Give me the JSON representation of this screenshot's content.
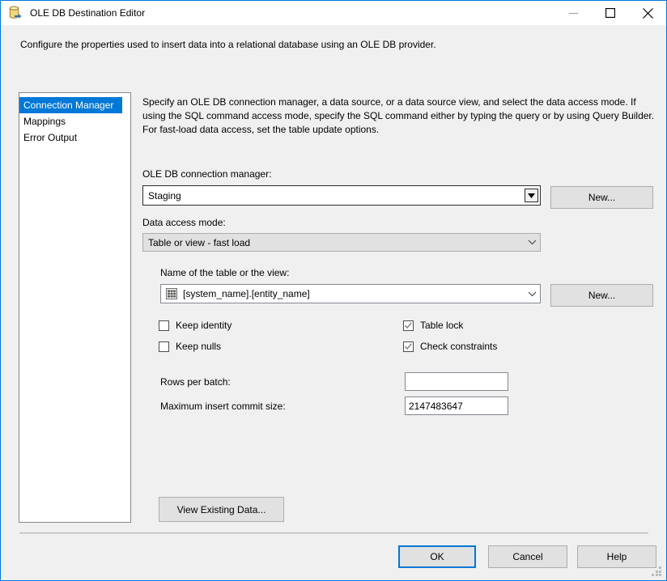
{
  "window": {
    "title": "OLE DB Destination Editor",
    "icon": "database-destination-icon",
    "minimize_label": "Minimize",
    "maximize_label": "Maximize",
    "close_label": "Close"
  },
  "header": {
    "description": "Configure the properties used to insert data into a relational database using an OLE DB provider."
  },
  "nav": {
    "items": [
      {
        "label": "Connection Manager",
        "selected": true
      },
      {
        "label": "Mappings",
        "selected": false
      },
      {
        "label": "Error Output",
        "selected": false
      }
    ]
  },
  "pane": {
    "description": "Specify an OLE DB connection manager, a data source, or a data source view, and select the data access mode. If using the SQL command access mode, specify the SQL command either by typing the query or by using Query Builder. For fast-load data access, set the table update options.",
    "connection_manager": {
      "label": "OLE DB connection manager:",
      "value": "Staging",
      "new_button": "New..."
    },
    "data_access_mode": {
      "label": "Data access mode:",
      "value": "Table or view - fast load"
    },
    "table_or_view": {
      "label": "Name of the table or the view:",
      "value": "[system_name].[entity_name]",
      "icon": "table-grid-icon",
      "new_button": "New..."
    },
    "options": [
      {
        "label": "Keep identity",
        "checked": false
      },
      {
        "label": "Keep nulls",
        "checked": false
      },
      {
        "label": "Table lock",
        "checked": true
      },
      {
        "label": "Check constraints",
        "checked": true
      }
    ],
    "rows_per_batch": {
      "label": "Rows per batch:",
      "value": ""
    },
    "max_insert_commit_size": {
      "label": "Maximum insert commit size:",
      "value": "2147483647"
    },
    "view_existing_data_button": "View Existing Data..."
  },
  "footer": {
    "ok": "OK",
    "cancel": "Cancel",
    "help": "Help"
  },
  "colors": {
    "accent": "#0078d7",
    "window_bg": "#f0f0f0",
    "field_bg": "#ffffff",
    "button_bg": "#e1e1e1"
  }
}
